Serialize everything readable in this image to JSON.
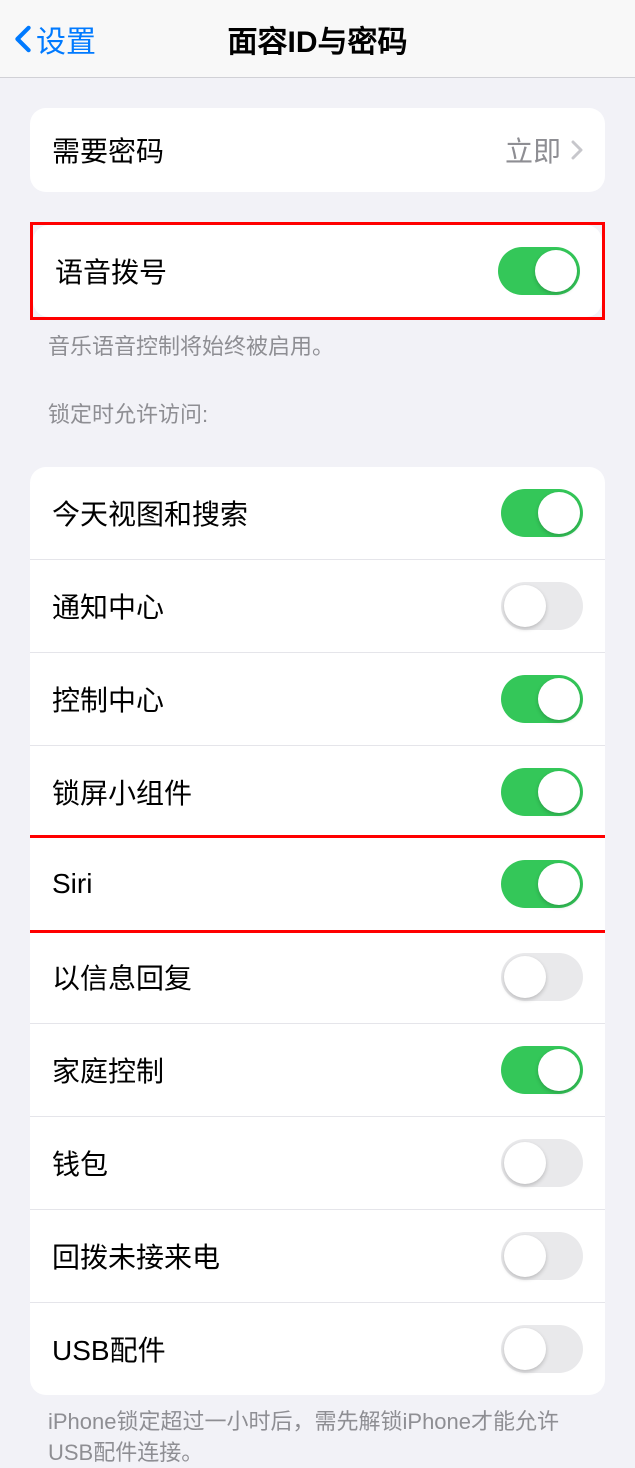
{
  "header": {
    "back_label": "设置",
    "title": "面容ID与密码"
  },
  "passcode_section": {
    "require_passcode_label": "需要密码",
    "require_passcode_value": "立即"
  },
  "voice_dial": {
    "label": "语音拨号",
    "on": true,
    "footer": "音乐语音控制将始终被启用。"
  },
  "lock_access": {
    "header": "锁定时允许访问:",
    "items": [
      {
        "label": "今天视图和搜索",
        "on": true,
        "highlight": false
      },
      {
        "label": "通知中心",
        "on": false,
        "highlight": false
      },
      {
        "label": "控制中心",
        "on": true,
        "highlight": false
      },
      {
        "label": "锁屏小组件",
        "on": true,
        "highlight": false
      },
      {
        "label": "Siri",
        "on": true,
        "highlight": true
      },
      {
        "label": "以信息回复",
        "on": false,
        "highlight": false
      },
      {
        "label": "家庭控制",
        "on": true,
        "highlight": false
      },
      {
        "label": "钱包",
        "on": false,
        "highlight": false
      },
      {
        "label": "回拨未接来电",
        "on": false,
        "highlight": false
      },
      {
        "label": "USB配件",
        "on": false,
        "highlight": false
      }
    ],
    "footer": "iPhone锁定超过一小时后，需先解锁iPhone才能允许USB配件连接。"
  }
}
